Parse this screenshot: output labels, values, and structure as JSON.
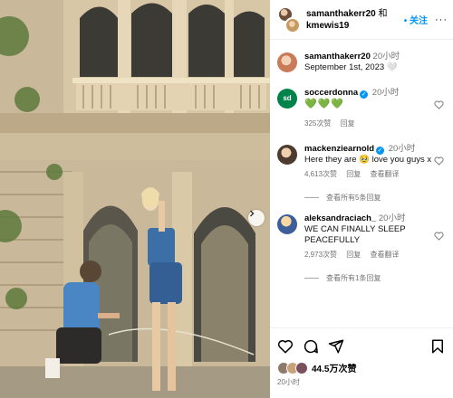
{
  "header": {
    "user1": "samanthakerr20",
    "connector": "和",
    "user2": "kmewis19",
    "follow_label": "• 关注",
    "more_label": "···"
  },
  "caption": {
    "username": "samanthakerr20",
    "time": "20小时",
    "text": "September 1st, 2023 🤍"
  },
  "comments": [
    {
      "username": "soccerdonna",
      "verified": true,
      "time": "20小时",
      "text": "💚💚💚",
      "likes": "325次赞",
      "reply": "回复",
      "translate": ""
    },
    {
      "username": "mackenziearnold",
      "verified": true,
      "time": "20小时",
      "text": "Here they are 🥹 love you guys x",
      "likes": "4,613次赞",
      "reply": "回复",
      "translate": "查看翻译",
      "view_replies": "查看所有5条回复"
    },
    {
      "username": "aleksandraciach_",
      "verified": false,
      "time": "20小时",
      "text": "WE CAN FINALLY SLEEP PEACEFULLY",
      "likes": "2,973次赞",
      "reply": "回复",
      "translate": "查看翻译",
      "view_replies": "查看所有1条回复"
    }
  ],
  "icons": [
    "heart-icon",
    "comment-icon",
    "share-icon",
    "bookmark-icon",
    "verified-icon",
    "chevron-right-icon",
    "more-icon"
  ],
  "likes_count": "44.5万次赞",
  "post_time": "20小时",
  "colors": {
    "accent": "#0095f6",
    "muted": "#737373",
    "green_heart": "#2fb52f"
  }
}
